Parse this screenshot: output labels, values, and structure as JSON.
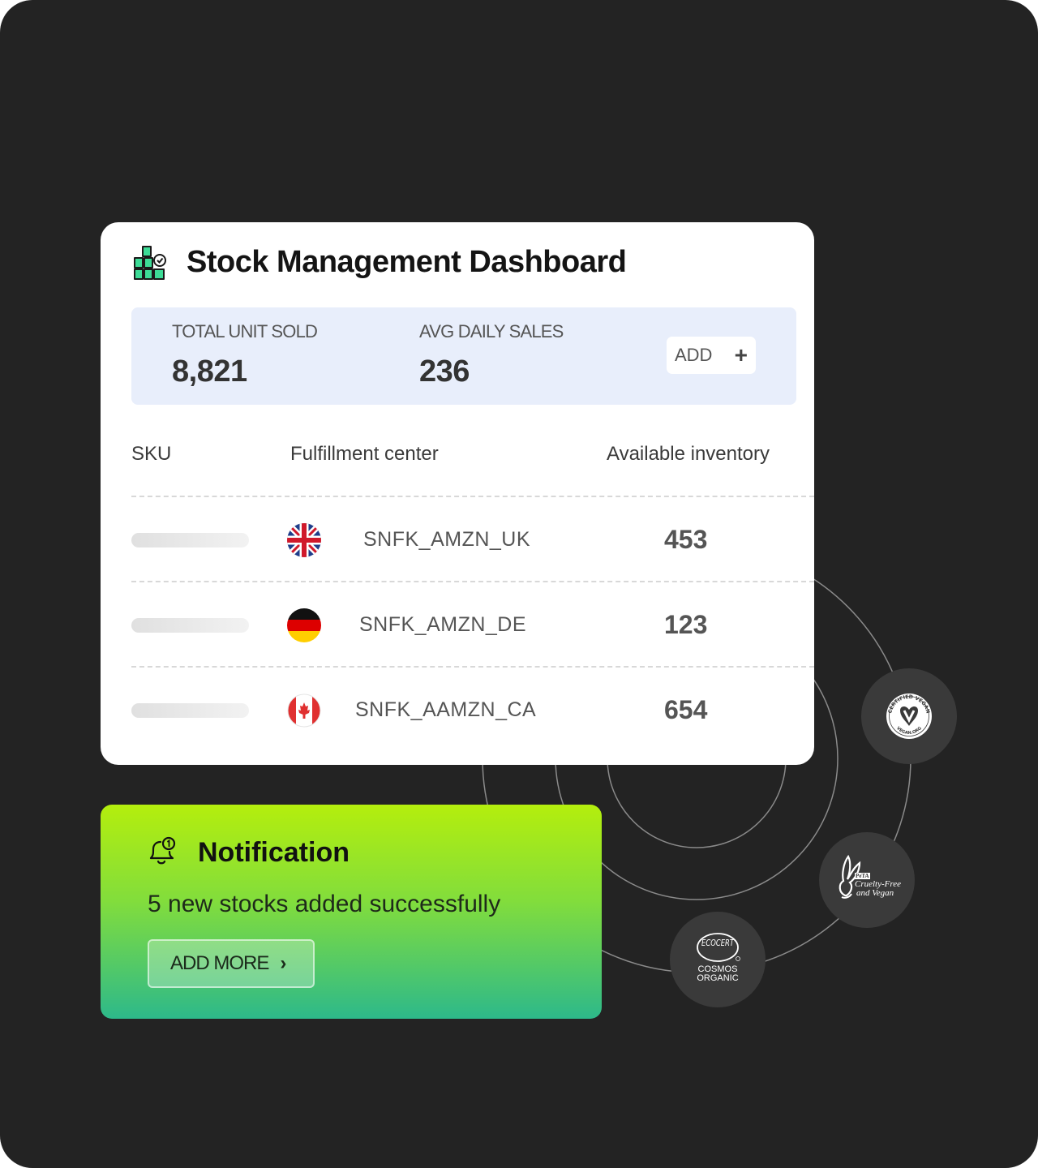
{
  "dashboard": {
    "title": "Stock Management Dashboard",
    "stats": {
      "total_label": "TOTAL UNIT SOLD",
      "total_value": "8,821",
      "avg_label": "AVG DAILY SALES",
      "avg_value": "236",
      "add_label": "ADD",
      "add_icon": "plus-icon"
    },
    "table": {
      "headers": [
        "SKU",
        "Fulfillment center",
        "Available inventory"
      ],
      "rows": [
        {
          "country": "uk-flag-icon",
          "center": "SNFK_AMZN_UK",
          "inventory": "453"
        },
        {
          "country": "de-flag-icon",
          "center": "SNFK_AMZN_DE",
          "inventory": "123"
        },
        {
          "country": "ca-flag-icon",
          "center": "SNFK_AAMZN_CA",
          "inventory": "654"
        }
      ]
    }
  },
  "notification": {
    "title": "Notification",
    "message": "5 new stocks added successfully",
    "button_label": "ADD MORE",
    "icon": "bell-icon"
  },
  "certifications": {
    "vegan": {
      "top_text": "CERTIFIED VEGAN",
      "bottom_text": "VEGAN.ORG"
    },
    "peta": {
      "brand": "PeTA",
      "line1": "Cruelty-Free",
      "line2": "and Vegan"
    },
    "ecocert": {
      "logo_text": "ECOCERT",
      "line1": "COSMOS",
      "line2": "ORGANIC"
    }
  },
  "colors": {
    "background": "#232323",
    "card": "#ffffff",
    "stats_panel": "#e8eefb",
    "accent_green": "#3ddc97",
    "notif_top": "#b4ee0d",
    "notif_bottom": "#2db98a"
  }
}
